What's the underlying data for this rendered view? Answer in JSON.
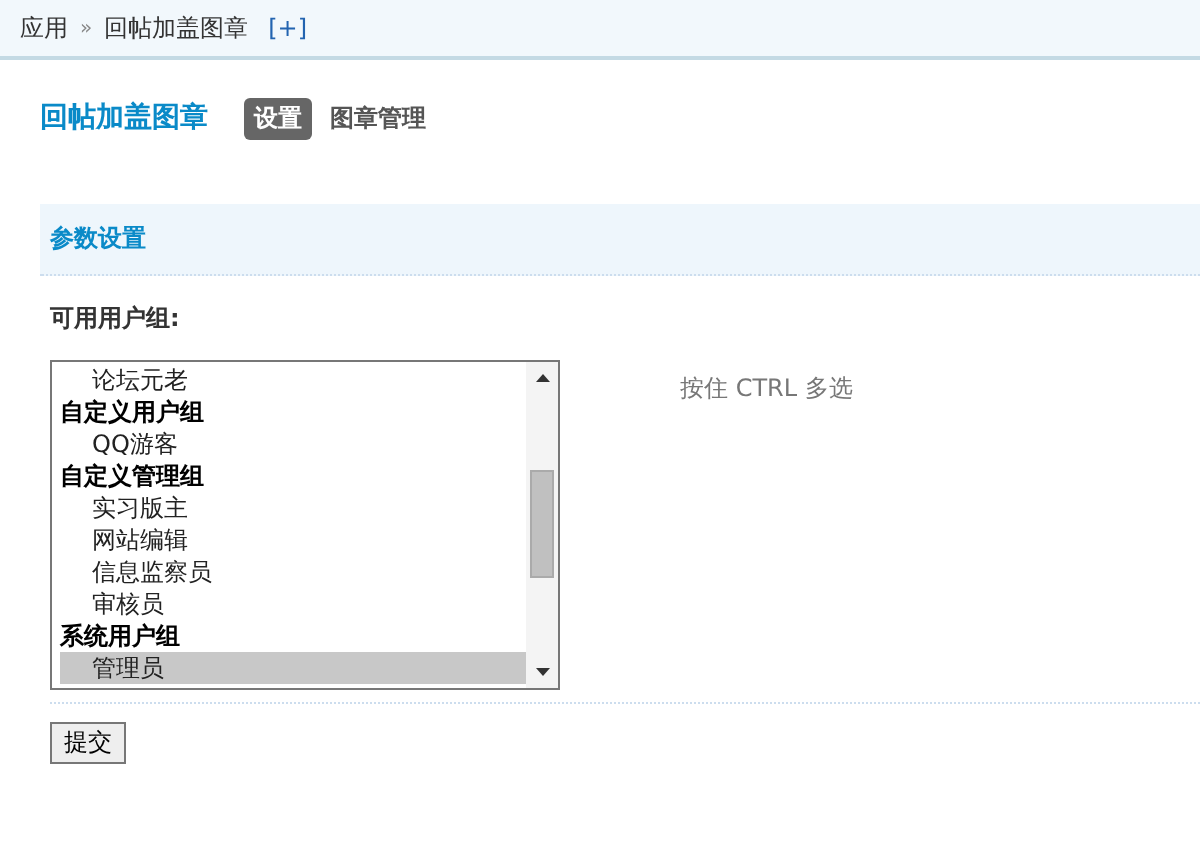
{
  "breadcrumb": {
    "items": [
      "应用",
      "回帖加盖图章"
    ],
    "separator": "»",
    "add_link": "[+]"
  },
  "header": {
    "title": "回帖加盖图章",
    "tabs": [
      {
        "label": "设置",
        "selected": true
      },
      {
        "label": "图章管理",
        "selected": false
      }
    ]
  },
  "section": {
    "title": "参数设置"
  },
  "field": {
    "label": "可用用户组:",
    "hint": "按住 CTRL 多选",
    "options": [
      {
        "kind": "option",
        "label": "论坛元老",
        "selected": false
      },
      {
        "kind": "group",
        "label": "自定义用户组"
      },
      {
        "kind": "option",
        "label": "QQ游客",
        "selected": false
      },
      {
        "kind": "group",
        "label": "自定义管理组"
      },
      {
        "kind": "option",
        "label": "实习版主",
        "selected": false
      },
      {
        "kind": "option",
        "label": "网站编辑",
        "selected": false
      },
      {
        "kind": "option",
        "label": "信息监察员",
        "selected": false
      },
      {
        "kind": "option",
        "label": "审核员",
        "selected": false
      },
      {
        "kind": "group",
        "label": "系统用户组"
      },
      {
        "kind": "option",
        "label": "管理员",
        "selected": true
      }
    ]
  },
  "submit": {
    "label": "提交"
  }
}
